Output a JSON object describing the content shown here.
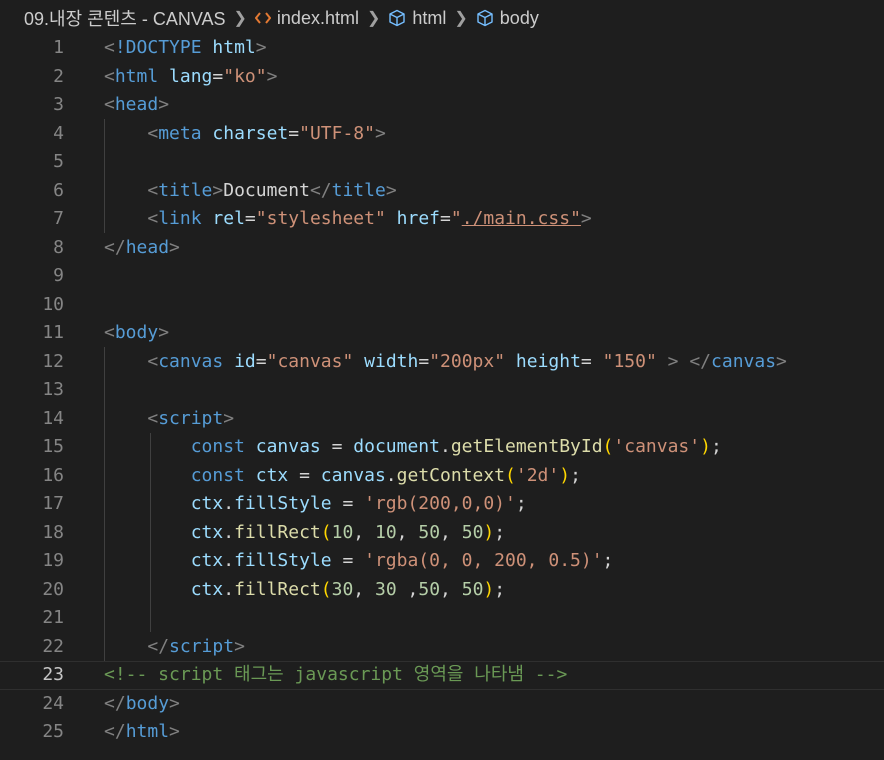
{
  "breadcrumb": {
    "folder": "09.내장 콘텐츠 - CANVAS",
    "file": "index.html",
    "el1": "html",
    "el2": "body"
  },
  "editor": {
    "current_line": 23,
    "lines": [
      {
        "n": "1",
        "tokens": [
          [
            "t-br",
            "<"
          ],
          [
            "t-tag",
            "!DOCTYPE"
          ],
          [
            "t-txt",
            " "
          ],
          [
            "t-attr",
            "html"
          ],
          [
            "t-br",
            ">"
          ]
        ]
      },
      {
        "n": "2",
        "tokens": [
          [
            "t-br",
            "<"
          ],
          [
            "t-tag",
            "html"
          ],
          [
            "t-txt",
            " "
          ],
          [
            "t-attr",
            "lang"
          ],
          [
            "t-txt",
            "="
          ],
          [
            "t-str",
            "\"ko\""
          ],
          [
            "t-br",
            ">"
          ]
        ]
      },
      {
        "n": "3",
        "tokens": [
          [
            "t-br",
            "<"
          ],
          [
            "t-tag",
            "head"
          ],
          [
            "t-br",
            ">"
          ]
        ]
      },
      {
        "n": "4",
        "tokens": [
          [
            "t-txt",
            "    "
          ],
          [
            "t-br",
            "<"
          ],
          [
            "t-tag",
            "meta"
          ],
          [
            "t-txt",
            " "
          ],
          [
            "t-attr",
            "charset"
          ],
          [
            "t-txt",
            "="
          ],
          [
            "t-str",
            "\"UTF-8\""
          ],
          [
            "t-br",
            ">"
          ]
        ]
      },
      {
        "n": "5",
        "tokens": []
      },
      {
        "n": "6",
        "tokens": [
          [
            "t-txt",
            "    "
          ],
          [
            "t-br",
            "<"
          ],
          [
            "t-tag",
            "title"
          ],
          [
            "t-br",
            ">"
          ],
          [
            "t-txt",
            "Document"
          ],
          [
            "t-br",
            "</"
          ],
          [
            "t-tag",
            "title"
          ],
          [
            "t-br",
            ">"
          ]
        ]
      },
      {
        "n": "7",
        "tokens": [
          [
            "t-txt",
            "    "
          ],
          [
            "t-br",
            "<"
          ],
          [
            "t-tag",
            "link"
          ],
          [
            "t-txt",
            " "
          ],
          [
            "t-attr",
            "rel"
          ],
          [
            "t-txt",
            "="
          ],
          [
            "t-str",
            "\"stylesheet\""
          ],
          [
            "t-txt",
            " "
          ],
          [
            "t-attr",
            "href"
          ],
          [
            "t-txt",
            "="
          ],
          [
            "t-str",
            "\""
          ],
          [
            "t-str link-ul",
            "./main.css\""
          ],
          [
            "t-br",
            ">"
          ]
        ]
      },
      {
        "n": "8",
        "tokens": [
          [
            "t-br",
            "</"
          ],
          [
            "t-tag",
            "head"
          ],
          [
            "t-br",
            ">"
          ]
        ]
      },
      {
        "n": "9",
        "tokens": []
      },
      {
        "n": "10",
        "tokens": []
      },
      {
        "n": "11",
        "tokens": [
          [
            "t-br",
            "<"
          ],
          [
            "t-tag",
            "body"
          ],
          [
            "t-br",
            ">"
          ]
        ]
      },
      {
        "n": "12",
        "tokens": [
          [
            "t-txt",
            "    "
          ],
          [
            "t-br",
            "<"
          ],
          [
            "t-tag",
            "canvas"
          ],
          [
            "t-txt",
            " "
          ],
          [
            "t-attr",
            "id"
          ],
          [
            "t-txt",
            "="
          ],
          [
            "t-str",
            "\"canvas\""
          ],
          [
            "t-txt",
            " "
          ],
          [
            "t-attr",
            "width"
          ],
          [
            "t-txt",
            "="
          ],
          [
            "t-str",
            "\"200px\""
          ],
          [
            "t-txt",
            " "
          ],
          [
            "t-attr",
            "height"
          ],
          [
            "t-txt",
            "= "
          ],
          [
            "t-str",
            "\"150\""
          ],
          [
            "t-txt",
            " "
          ],
          [
            "t-br",
            ">"
          ],
          [
            "t-txt",
            " "
          ],
          [
            "t-br",
            "</"
          ],
          [
            "t-tag",
            "canvas"
          ],
          [
            "t-br",
            ">"
          ]
        ]
      },
      {
        "n": "13",
        "tokens": []
      },
      {
        "n": "14",
        "tokens": [
          [
            "t-txt",
            "    "
          ],
          [
            "t-br",
            "<"
          ],
          [
            "t-tag",
            "script"
          ],
          [
            "t-br",
            ">"
          ]
        ]
      },
      {
        "n": "15",
        "tokens": [
          [
            "t-txt",
            "        "
          ],
          [
            "t-kw",
            "const"
          ],
          [
            "t-txt",
            " "
          ],
          [
            "t-var",
            "canvas"
          ],
          [
            "t-txt",
            " = "
          ],
          [
            "t-var",
            "document"
          ],
          [
            "t-txt",
            "."
          ],
          [
            "t-fn",
            "getElementById"
          ],
          [
            "t-p1",
            "("
          ],
          [
            "t-str",
            "'canvas'"
          ],
          [
            "t-p1",
            ")"
          ],
          [
            "t-txt",
            ";"
          ]
        ]
      },
      {
        "n": "16",
        "tokens": [
          [
            "t-txt",
            "        "
          ],
          [
            "t-kw",
            "const"
          ],
          [
            "t-txt",
            " "
          ],
          [
            "t-var",
            "ctx"
          ],
          [
            "t-txt",
            " = "
          ],
          [
            "t-var",
            "canvas"
          ],
          [
            "t-txt",
            "."
          ],
          [
            "t-fn",
            "getContext"
          ],
          [
            "t-p1",
            "("
          ],
          [
            "t-str",
            "'2d'"
          ],
          [
            "t-p1",
            ")"
          ],
          [
            "t-txt",
            ";"
          ]
        ]
      },
      {
        "n": "17",
        "tokens": [
          [
            "t-txt",
            "        "
          ],
          [
            "t-var",
            "ctx"
          ],
          [
            "t-txt",
            "."
          ],
          [
            "t-var",
            "fillStyle"
          ],
          [
            "t-txt",
            " = "
          ],
          [
            "t-str",
            "'rgb(200,0,0)'"
          ],
          [
            "t-txt",
            ";"
          ]
        ]
      },
      {
        "n": "18",
        "tokens": [
          [
            "t-txt",
            "        "
          ],
          [
            "t-var",
            "ctx"
          ],
          [
            "t-txt",
            "."
          ],
          [
            "t-fn",
            "fillRect"
          ],
          [
            "t-p1",
            "("
          ],
          [
            "t-num",
            "10"
          ],
          [
            "t-txt",
            ", "
          ],
          [
            "t-num",
            "10"
          ],
          [
            "t-txt",
            ", "
          ],
          [
            "t-num",
            "50"
          ],
          [
            "t-txt",
            ", "
          ],
          [
            "t-num",
            "50"
          ],
          [
            "t-p1",
            ")"
          ],
          [
            "t-txt",
            ";"
          ]
        ]
      },
      {
        "n": "19",
        "tokens": [
          [
            "t-txt",
            "        "
          ],
          [
            "t-var",
            "ctx"
          ],
          [
            "t-txt",
            "."
          ],
          [
            "t-var",
            "fillStyle"
          ],
          [
            "t-txt",
            " = "
          ],
          [
            "t-str",
            "'rgba(0, 0, 200, 0.5)'"
          ],
          [
            "t-txt",
            ";"
          ]
        ]
      },
      {
        "n": "20",
        "tokens": [
          [
            "t-txt",
            "        "
          ],
          [
            "t-var",
            "ctx"
          ],
          [
            "t-txt",
            "."
          ],
          [
            "t-fn",
            "fillRect"
          ],
          [
            "t-p1",
            "("
          ],
          [
            "t-num",
            "30"
          ],
          [
            "t-txt",
            ", "
          ],
          [
            "t-num",
            "30"
          ],
          [
            "t-txt",
            " ,"
          ],
          [
            "t-num",
            "50"
          ],
          [
            "t-txt",
            ", "
          ],
          [
            "t-num",
            "50"
          ],
          [
            "t-p1",
            ")"
          ],
          [
            "t-txt",
            ";"
          ]
        ]
      },
      {
        "n": "21",
        "tokens": []
      },
      {
        "n": "22",
        "tokens": [
          [
            "t-txt",
            "    "
          ],
          [
            "t-br",
            "</"
          ],
          [
            "t-tag",
            "script"
          ],
          [
            "t-br",
            ">"
          ]
        ]
      },
      {
        "n": "23",
        "tokens": [
          [
            "t-com",
            "<!-- script 태그는 javascript 영역을 나타냄 -->"
          ]
        ]
      },
      {
        "n": "24",
        "tokens": [
          [
            "t-br",
            "</"
          ],
          [
            "t-tag",
            "body"
          ],
          [
            "t-br",
            ">"
          ]
        ]
      },
      {
        "n": "25",
        "tokens": [
          [
            "t-br",
            "</"
          ],
          [
            "t-tag",
            "html"
          ],
          [
            "t-br",
            ">"
          ]
        ]
      }
    ]
  }
}
